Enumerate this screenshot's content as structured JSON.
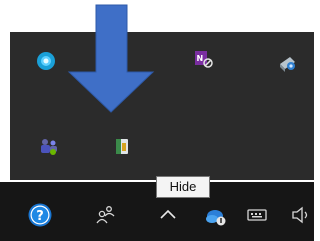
{
  "tooltip": {
    "text": "Hide"
  },
  "flyout": {
    "icons": [
      {
        "name": "blue-circle-app-icon"
      },
      {
        "name": "onenote-icon"
      },
      {
        "name": "network-drive-icon"
      },
      {
        "name": "teams-icon"
      },
      {
        "name": "file-security-icon"
      }
    ]
  },
  "taskbar": {
    "icons": [
      {
        "name": "help-icon"
      },
      {
        "name": "people-icon"
      },
      {
        "name": "chevron-up-icon"
      },
      {
        "name": "onedrive-icon"
      },
      {
        "name": "keyboard-icon"
      },
      {
        "name": "speaker-icon"
      }
    ]
  },
  "colors": {
    "flyout_bg": "#2b2b2b",
    "taskbar_bg": "#161616",
    "arrow": "#3f6fc7"
  }
}
